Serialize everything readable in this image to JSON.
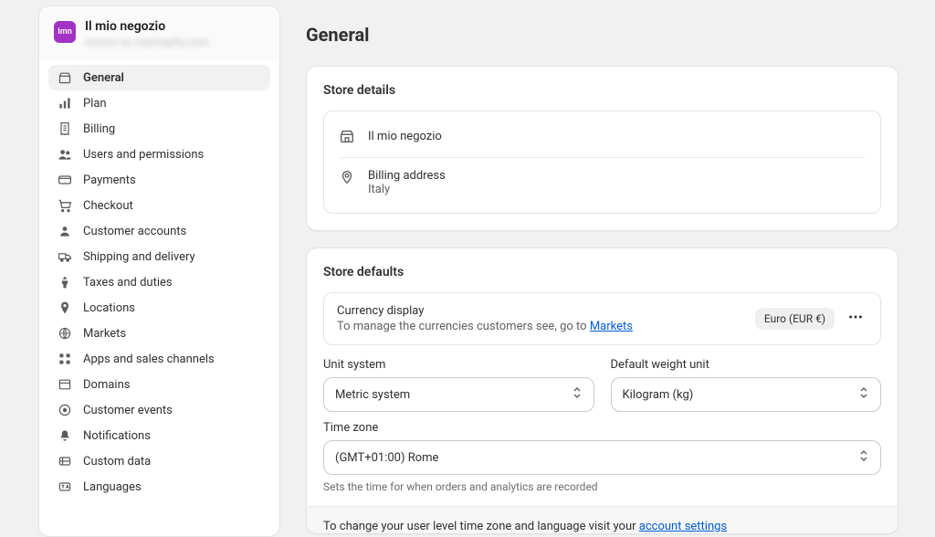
{
  "store": {
    "name": "Il mio negozio",
    "url_masked": "xxxxxx.xx.myshopify.com",
    "badge_text": "Imn"
  },
  "sidebar": {
    "items": [
      {
        "label": "General",
        "active": true,
        "icon": "settings-home-icon"
      },
      {
        "label": "Plan",
        "icon": "chart-icon"
      },
      {
        "label": "Billing",
        "icon": "receipt-icon"
      },
      {
        "label": "Users and permissions",
        "icon": "users-icon"
      },
      {
        "label": "Payments",
        "icon": "card-icon"
      },
      {
        "label": "Checkout",
        "icon": "cart-icon"
      },
      {
        "label": "Customer accounts",
        "icon": "person-icon"
      },
      {
        "label": "Shipping and delivery",
        "icon": "truck-icon"
      },
      {
        "label": "Taxes and duties",
        "icon": "tax-icon"
      },
      {
        "label": "Locations",
        "icon": "location-icon"
      },
      {
        "label": "Markets",
        "icon": "globe-icon"
      },
      {
        "label": "Apps and sales channels",
        "icon": "apps-icon"
      },
      {
        "label": "Domains",
        "icon": "domains-icon"
      },
      {
        "label": "Customer events",
        "icon": "events-icon"
      },
      {
        "label": "Notifications",
        "icon": "bell-icon"
      },
      {
        "label": "Custom data",
        "icon": "data-icon"
      },
      {
        "label": "Languages",
        "icon": "lang-icon"
      }
    ]
  },
  "page": {
    "title": "General"
  },
  "store_details": {
    "heading": "Store details",
    "store_name": "Il mio negozio",
    "billing_label": "Billing address",
    "billing_value": "Italy"
  },
  "store_defaults": {
    "heading": "Store defaults",
    "currency_display_label": "Currency display",
    "currency_hint_prefix": "To manage the currencies customers see, go to ",
    "currency_hint_link": "Markets",
    "currency_value": "Euro (EUR €)",
    "unit_system_label": "Unit system",
    "unit_system_value": "Metric system",
    "weight_unit_label": "Default weight unit",
    "weight_unit_value": "Kilogram (kg)",
    "timezone_label": "Time zone",
    "timezone_value": "(GMT+01:00) Rome",
    "timezone_hint": "Sets the time for when orders and analytics are recorded",
    "footer_prefix": "To change your user level time zone and language visit your ",
    "footer_link": "account settings"
  },
  "icons": {
    "updown": "⇅"
  }
}
